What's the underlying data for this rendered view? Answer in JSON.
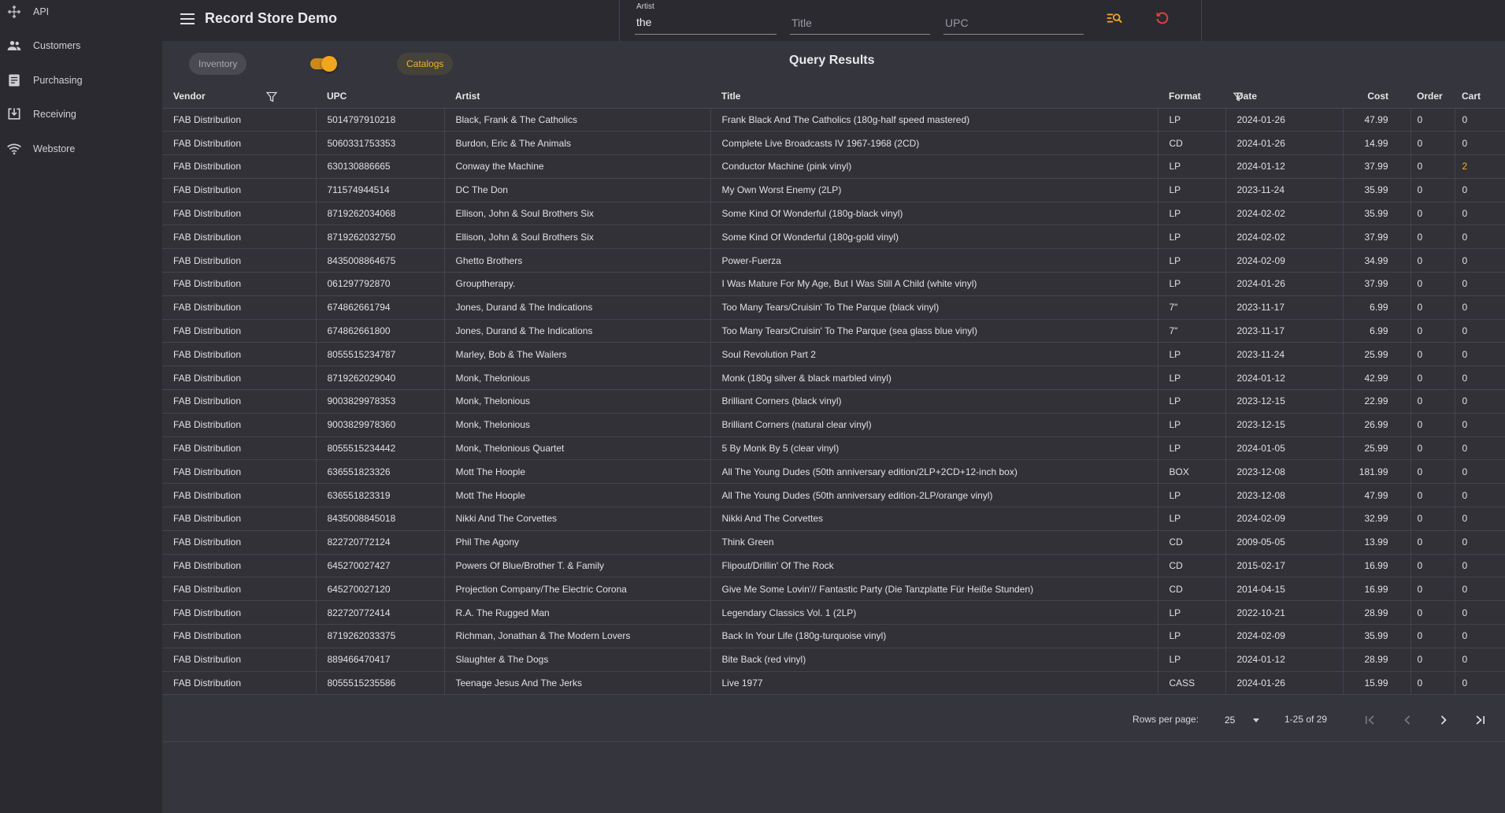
{
  "sidebar": {
    "items": [
      {
        "label": "API",
        "icon": "api-icon"
      },
      {
        "label": "Customers",
        "icon": "people-icon"
      },
      {
        "label": "Purchasing",
        "icon": "receipt-icon"
      },
      {
        "label": "Receiving",
        "icon": "inbox-download-icon"
      },
      {
        "label": "Webstore",
        "icon": "wifi-icon"
      }
    ]
  },
  "header": {
    "title": "Record Store Demo",
    "search": {
      "artist_label": "Artist",
      "artist_value": "the",
      "title_placeholder": "Title",
      "upc_placeholder": "UPC"
    }
  },
  "toolbar": {
    "inventory_label": "Inventory",
    "catalogs_label": "Catalogs",
    "results_title": "Query Results",
    "toggle_on": true
  },
  "colors": {
    "accent": "#f3a51e",
    "reset": "#e0413a",
    "background": "#35353d",
    "sidebar": "#2a2a30"
  },
  "table": {
    "columns": [
      "Vendor",
      "UPC",
      "Artist",
      "Title",
      "Format",
      "Date",
      "Cost",
      "Order",
      "Cart"
    ],
    "rows": [
      [
        "FAB Distribution",
        "5014797910218",
        "Black, Frank & The Catholics",
        "Frank Black And The Catholics (180g-half speed mastered)",
        "LP",
        "2024-01-26",
        "47.99",
        "0",
        "0"
      ],
      [
        "FAB Distribution",
        "5060331753353",
        "Burdon, Eric & The Animals",
        "Complete Live Broadcasts IV 1967-1968 (2CD)",
        "CD",
        "2024-01-26",
        "14.99",
        "0",
        "0"
      ],
      [
        "FAB Distribution",
        "630130886665",
        "Conway the Machine",
        "Conductor Machine (pink vinyl)",
        "LP",
        "2024-01-12",
        "37.99",
        "0",
        "2"
      ],
      [
        "FAB Distribution",
        "711574944514",
        "DC The Don",
        "My Own Worst Enemy (2LP)",
        "LP",
        "2023-11-24",
        "35.99",
        "0",
        "0"
      ],
      [
        "FAB Distribution",
        "8719262034068",
        "Ellison, John & Soul Brothers Six",
        "Some Kind Of Wonderful (180g-black vinyl)",
        "LP",
        "2024-02-02",
        "35.99",
        "0",
        "0"
      ],
      [
        "FAB Distribution",
        "8719262032750",
        "Ellison, John & Soul Brothers Six",
        "Some Kind Of Wonderful (180g-gold vinyl)",
        "LP",
        "2024-02-02",
        "37.99",
        "0",
        "0"
      ],
      [
        "FAB Distribution",
        "8435008864675",
        "Ghetto Brothers",
        "Power-Fuerza",
        "LP",
        "2024-02-09",
        "34.99",
        "0",
        "0"
      ],
      [
        "FAB Distribution",
        "061297792870",
        "Grouptherapy.",
        "I Was Mature For My Age, But I Was Still A Child (white vinyl)",
        "LP",
        "2024-01-26",
        "37.99",
        "0",
        "0"
      ],
      [
        "FAB Distribution",
        "674862661794",
        "Jones, Durand & The Indications",
        "Too Many Tears/Cruisin' To The Parque (black vinyl)",
        "7\"",
        "2023-11-17",
        "6.99",
        "0",
        "0"
      ],
      [
        "FAB Distribution",
        "674862661800",
        "Jones, Durand & The Indications",
        "Too Many Tears/Cruisin' To The Parque (sea glass blue vinyl)",
        "7\"",
        "2023-11-17",
        "6.99",
        "0",
        "0"
      ],
      [
        "FAB Distribution",
        "8055515234787",
        "Marley, Bob & The Wailers",
        "Soul Revolution Part 2",
        "LP",
        "2023-11-24",
        "25.99",
        "0",
        "0"
      ],
      [
        "FAB Distribution",
        "8719262029040",
        "Monk, Thelonious",
        "Monk (180g silver & black marbled vinyl)",
        "LP",
        "2024-01-12",
        "42.99",
        "0",
        "0"
      ],
      [
        "FAB Distribution",
        "9003829978353",
        "Monk, Thelonious",
        "Brilliant Corners (black vinyl)",
        "LP",
        "2023-12-15",
        "22.99",
        "0",
        "0"
      ],
      [
        "FAB Distribution",
        "9003829978360",
        "Monk, Thelonious",
        "Brilliant Corners (natural clear vinyl)",
        "LP",
        "2023-12-15",
        "26.99",
        "0",
        "0"
      ],
      [
        "FAB Distribution",
        "8055515234442",
        "Monk, Thelonious Quartet",
        "5 By Monk By 5 (clear vinyl)",
        "LP",
        "2024-01-05",
        "25.99",
        "0",
        "0"
      ],
      [
        "FAB Distribution",
        "636551823326",
        "Mott The Hoople",
        "All The Young Dudes (50th anniversary edition/2LP+2CD+12-inch box)",
        "BOX",
        "2023-12-08",
        "181.99",
        "0",
        "0"
      ],
      [
        "FAB Distribution",
        "636551823319",
        "Mott The Hoople",
        "All The Young Dudes (50th anniversary edition-2LP/orange vinyl)",
        "LP",
        "2023-12-08",
        "47.99",
        "0",
        "0"
      ],
      [
        "FAB Distribution",
        "8435008845018",
        "Nikki And The Corvettes",
        "Nikki And The Corvettes",
        "LP",
        "2024-02-09",
        "32.99",
        "0",
        "0"
      ],
      [
        "FAB Distribution",
        "822720772124",
        "Phil The Agony",
        "Think Green",
        "CD",
        "2009-05-05",
        "13.99",
        "0",
        "0"
      ],
      [
        "FAB Distribution",
        "645270027427",
        "Powers Of Blue/Brother T. & Family",
        "Flipout/Drillin' Of The Rock",
        "CD",
        "2015-02-17",
        "16.99",
        "0",
        "0"
      ],
      [
        "FAB Distribution",
        "645270027120",
        "Projection Company/The Electric Corona",
        "Give Me Some Lovin'// Fantastic Party (Die Tanzplatte Für Heiße Stunden)",
        "CD",
        "2014-04-15",
        "16.99",
        "0",
        "0"
      ],
      [
        "FAB Distribution",
        "822720772414",
        "R.A. The Rugged Man",
        "Legendary Classics Vol. 1 (2LP)",
        "LP",
        "2022-10-21",
        "28.99",
        "0",
        "0"
      ],
      [
        "FAB Distribution",
        "8719262033375",
        "Richman, Jonathan & The Modern Lovers",
        "Back In Your Life (180g-turquoise vinyl)",
        "LP",
        "2024-02-09",
        "35.99",
        "0",
        "0"
      ],
      [
        "FAB Distribution",
        "889466470417",
        "Slaughter & The Dogs",
        "Bite Back (red vinyl)",
        "LP",
        "2024-01-12",
        "28.99",
        "0",
        "0"
      ],
      [
        "FAB Distribution",
        "8055515235586",
        "Teenage Jesus And The Jerks",
        "Live 1977",
        "CASS",
        "2024-01-26",
        "15.99",
        "0",
        "0"
      ]
    ]
  },
  "pagination": {
    "rows_per_page_label": "Rows per page:",
    "rows_per_page": "25",
    "range": "1-25 of 29"
  }
}
